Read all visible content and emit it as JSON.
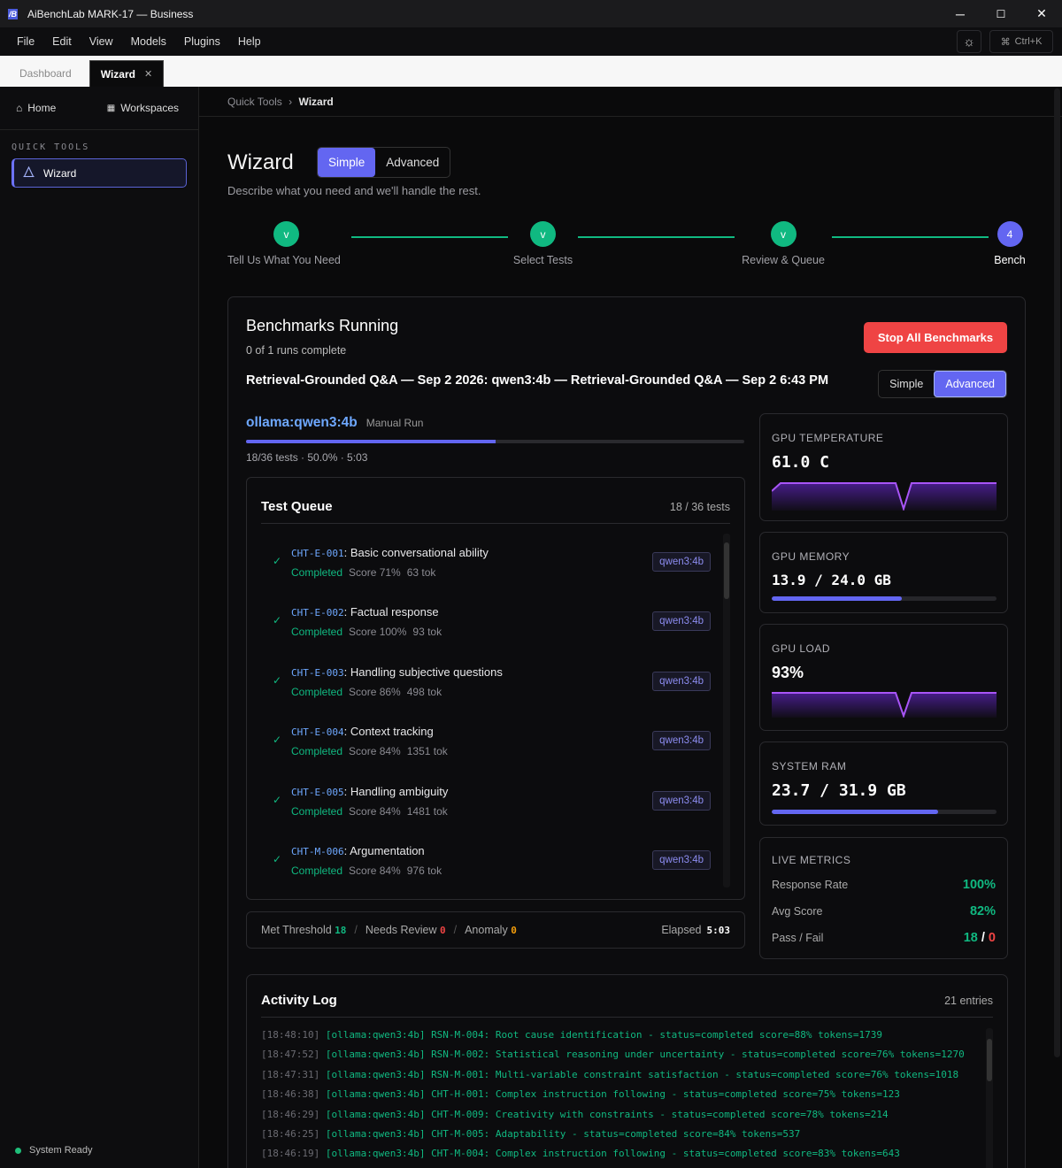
{
  "window": {
    "title": "AiBenchLab MARK-17 — Business",
    "logo_text": "/B",
    "minimize": "─",
    "maximize": "☐",
    "close": "✕"
  },
  "menu": [
    "File",
    "Edit",
    "View",
    "Models",
    "Plugins",
    "Help"
  ],
  "toolbar": {
    "theme_icon": "☼",
    "cmd_icon": "⌘",
    "cmd_shortcut": "Ctrl+K"
  },
  "tabs": [
    {
      "label": "Dashboard",
      "active": false
    },
    {
      "label": "Wizard",
      "active": true,
      "close": "✕"
    }
  ],
  "sidebar": {
    "home_label": "Home",
    "home_icon": "⌂",
    "workspaces_label": "Workspaces",
    "workspaces_icon": "▦",
    "section_label": "QUICK TOOLS",
    "item_label": "Wizard",
    "item_icon": "⚠",
    "status": "System Ready"
  },
  "breadcrumb": {
    "parent": "Quick Tools",
    "sep": "›",
    "current": "Wizard"
  },
  "page": {
    "title": "Wizard",
    "mode_simple": "Simple",
    "mode_advanced": "Advanced",
    "subtitle": "Describe what you need and we'll handle the rest."
  },
  "steps": [
    {
      "label": "Tell Us What You Need",
      "mark": "v"
    },
    {
      "label": "Select Tests",
      "mark": "v"
    },
    {
      "label": "Review & Queue",
      "mark": "v"
    },
    {
      "label": "Bench",
      "mark": "4"
    }
  ],
  "bench": {
    "title": "Benchmarks Running",
    "subtitle": "0 of 1 runs complete",
    "stop_label": "Stop All Benchmarks",
    "run_name": "Retrieval-Grounded Q&A — Sep 2 2026: qwen3:4b — Retrieval-Grounded Q&A — Sep 2 6:43 PM",
    "view_simple": "Simple",
    "view_advanced": "Advanced",
    "model": "ollama:qwen3:4b",
    "run_kind": "Manual Run",
    "progress": 0.5,
    "stats": "18/36 tests · 50.0% · 5:03"
  },
  "queue": {
    "title": "Test Queue",
    "count": "18 / 36 tests",
    "items": [
      {
        "code": "CHT-E-001",
        "name": ": Basic conversational ability",
        "status": "Completed",
        "score": "Score 71%",
        "tokens": "63 tok",
        "model": "qwen3:4b"
      },
      {
        "code": "CHT-E-002",
        "name": ": Factual response",
        "status": "Completed",
        "score": "Score 100%",
        "tokens": "93 tok",
        "model": "qwen3:4b"
      },
      {
        "code": "CHT-E-003",
        "name": ": Handling subjective questions",
        "status": "Completed",
        "score": "Score 86%",
        "tokens": "498 tok",
        "model": "qwen3:4b"
      },
      {
        "code": "CHT-E-004",
        "name": ": Context tracking",
        "status": "Completed",
        "score": "Score 84%",
        "tokens": "1351 tok",
        "model": "qwen3:4b"
      },
      {
        "code": "CHT-E-005",
        "name": ": Handling ambiguity",
        "status": "Completed",
        "score": "Score 84%",
        "tokens": "1481 tok",
        "model": "qwen3:4b"
      },
      {
        "code": "CHT-M-006",
        "name": ": Argumentation",
        "status": "Completed",
        "score": "Score 84%",
        "tokens": "976 tok",
        "model": "qwen3:4b"
      }
    ]
  },
  "summary": {
    "met_label": "Met Threshold",
    "met_value": "18",
    "review_label": "Needs Review",
    "review_value": "0",
    "anomaly_label": "Anomaly",
    "anomaly_value": "0",
    "sep": "/",
    "elapsed_label": "Elapsed",
    "elapsed_value": "5:03"
  },
  "metrics": {
    "gpu_temp": {
      "label": "GPU TEMPERATURE",
      "value": "61.0 C"
    },
    "gpu_mem": {
      "label": "GPU MEMORY",
      "value": "13.9 / 24.0 GB",
      "fraction": 0.58
    },
    "gpu_load": {
      "label": "GPU LOAD",
      "value": "93%"
    },
    "ram": {
      "label": "SYSTEM RAM",
      "value": "23.7 / 31.9 GB",
      "fraction": 0.74
    },
    "live": {
      "label": "LIVE METRICS",
      "response_label": "Response Rate",
      "response_value": "100%",
      "avg_label": "Avg Score",
      "avg_value": "82%",
      "pf_label": "Pass / Fail",
      "pass_value": "18",
      "pf_sep": " / ",
      "fail_value": "0"
    },
    "accent": "#8b5cf6"
  },
  "log": {
    "title": "Activity Log",
    "count": "21 entries",
    "lines": [
      {
        "ts": "[18:48:10]",
        "msg": " [ollama:qwen3:4b] RSN-M-004: Root cause identification - status=completed score=88% tokens=1739"
      },
      {
        "ts": "[18:47:52]",
        "msg": " [ollama:qwen3:4b] RSN-M-002: Statistical reasoning under uncertainty - status=completed score=76% tokens=1270"
      },
      {
        "ts": "[18:47:31]",
        "msg": " [ollama:qwen3:4b] RSN-M-001: Multi-variable constraint satisfaction - status=completed score=76% tokens=1018"
      },
      {
        "ts": "[18:46:38]",
        "msg": " [ollama:qwen3:4b] CHT-H-001: Complex instruction following - status=completed score=75% tokens=123"
      },
      {
        "ts": "[18:46:29]",
        "msg": " [ollama:qwen3:4b] CHT-M-009: Creativity with constraints - status=completed score=78% tokens=214"
      },
      {
        "ts": "[18:46:25]",
        "msg": " [ollama:qwen3:4b] CHT-M-005: Adaptability - status=completed score=84% tokens=537"
      },
      {
        "ts": "[18:46:19]",
        "msg": " [ollama:qwen3:4b] CHT-M-004: Complex instruction following - status=completed score=83% tokens=643"
      }
    ]
  }
}
